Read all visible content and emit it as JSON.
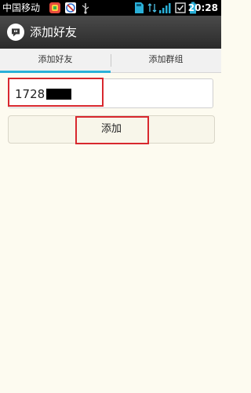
{
  "status_bar": {
    "carrier": "中国移动",
    "time": "20:28",
    "icons": [
      "notification-app-icon",
      "blocked-notification-icon",
      "usb-icon",
      "sd-card-icon",
      "data-arrows-icon",
      "signal-icon",
      "checkbox-icon",
      "battery-icon"
    ]
  },
  "title_bar": {
    "icon": "chat-bubble-icon",
    "title": "添加好友"
  },
  "tabs": [
    {
      "label": "添加好友",
      "selected": true
    },
    {
      "label": "添加群组",
      "selected": false
    }
  ],
  "form": {
    "input_value": "1728",
    "button_label": "添加"
  },
  "colors": {
    "accent": "#2ab0d8",
    "highlight": "#d8282e",
    "background": "#fdfbf0"
  }
}
